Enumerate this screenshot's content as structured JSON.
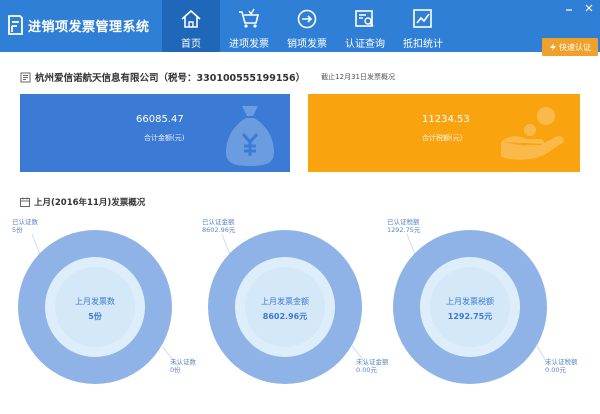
{
  "app": {
    "title": "进销项发票管理系统"
  },
  "nav": [
    {
      "label": "首页",
      "icon": "home-icon",
      "active": true
    },
    {
      "label": "进项发票",
      "icon": "cart-icon",
      "active": false
    },
    {
      "label": "销项发票",
      "icon": "arrow-circle-icon",
      "active": false
    },
    {
      "label": "认证查询",
      "icon": "search-doc-icon",
      "active": false
    },
    {
      "label": "抵扣统计",
      "icon": "chart-icon",
      "active": false
    }
  ],
  "quick_button": {
    "label": "快速认证"
  },
  "company": {
    "name": "杭州爱信诺航天信息有限公司（税号：330100555199156）",
    "period_note": "截止12月31日发票概况"
  },
  "cards": [
    {
      "value": "66085.47",
      "label": "合计金额(元)",
      "color": "#3b7bd6"
    },
    {
      "value": "11234.53",
      "label": "合计税额(元)",
      "color": "#f9a30f"
    }
  ],
  "month": {
    "title": "上月(2016年11月)发票概况"
  },
  "donuts": [
    {
      "center_title": "上月发票数",
      "center_value": "5份",
      "top_label": "已认证数",
      "top_value": "5份",
      "bottom_label": "未认证数",
      "bottom_value": "0份",
      "certified_fraction": 1.0
    },
    {
      "center_title": "上月发票金额",
      "center_value": "8602.96元",
      "top_label": "已认证金额",
      "top_value": "8602.96元",
      "bottom_label": "未认证金额",
      "bottom_value": "0.00元",
      "certified_fraction": 1.0
    },
    {
      "center_title": "上月发票税额",
      "center_value": "1292.75元",
      "top_label": "已认证税额",
      "top_value": "1292.75元",
      "bottom_label": "未认证税额",
      "bottom_value": "0.00元",
      "certified_fraction": 1.0
    }
  ],
  "colors": {
    "topbar": "#2f7fd6",
    "nav_active": "#1f67b9",
    "quick_button": "#f0a12a",
    "donut_ring": "#8fb3e6",
    "donut_inner": "#ddeefa",
    "donut_center": "#d5e8f8"
  }
}
